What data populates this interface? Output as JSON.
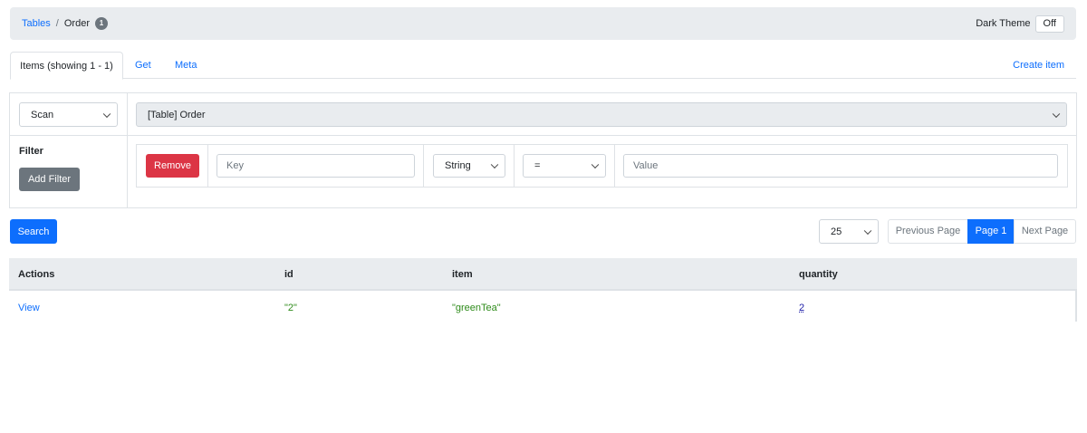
{
  "breadcrumb": {
    "root": "Tables",
    "separator": "/",
    "current": "Order",
    "badge": "1"
  },
  "theme": {
    "label": "Dark Theme",
    "toggle": "Off"
  },
  "tabs": {
    "items": [
      "Items (showing 1 - 1)",
      "Get",
      "Meta"
    ],
    "create": "Create item"
  },
  "query": {
    "operation": "Scan",
    "table": "[Table] Order",
    "filter_label": "Filter",
    "add_filter": "Add Filter",
    "filter": {
      "remove": "Remove",
      "key_placeholder": "Key",
      "type": "String",
      "operator": "=",
      "value_placeholder": "Value"
    }
  },
  "actions": {
    "search": "Search",
    "page_size": "25"
  },
  "pager": {
    "prev": "Previous Page",
    "current": "Page 1",
    "next": "Next Page"
  },
  "results": {
    "headers": [
      "Actions",
      "id",
      "item",
      "quantity"
    ],
    "rows": [
      {
        "action": "View",
        "id": "\"2\"",
        "item": "\"greenTea\"",
        "quantity": "2"
      }
    ]
  },
  "colors": {
    "primary": "#0d6efd",
    "danger": "#dc3545",
    "secondary": "#6c757d",
    "string": "#2e8b1a"
  }
}
